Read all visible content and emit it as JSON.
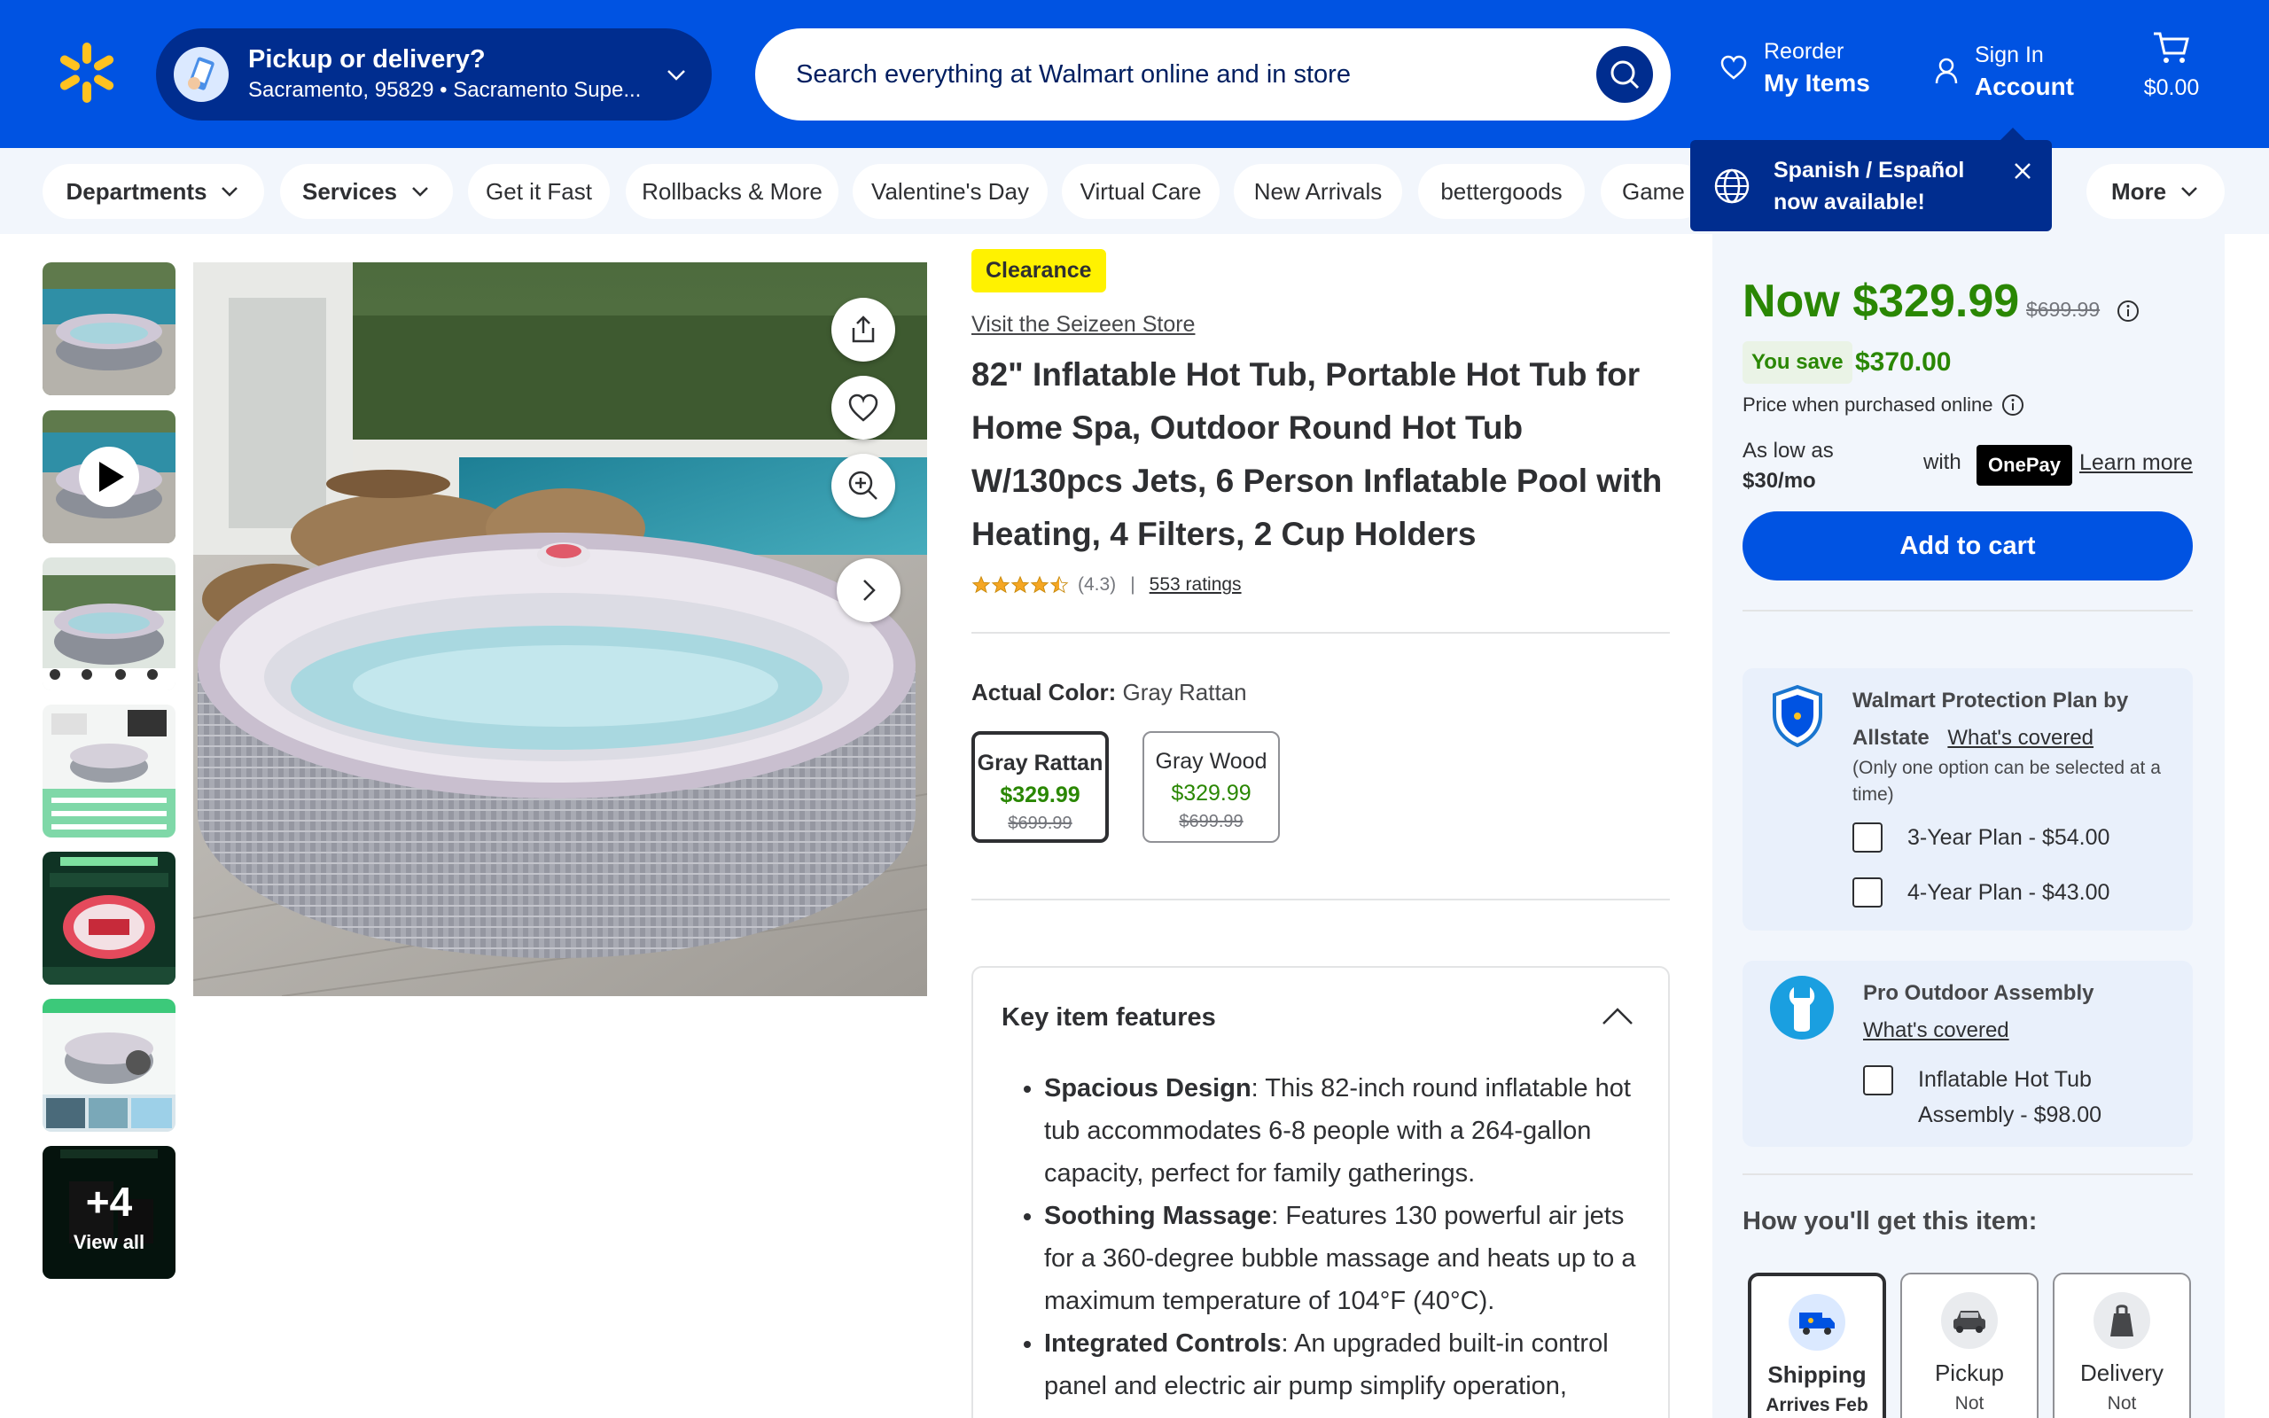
{
  "header": {
    "pickup_title": "Pickup or delivery?",
    "pickup_location": "Sacramento, 95829 • Sacramento Supe...",
    "search_placeholder": "Search everything at Walmart online and in store",
    "reorder_label": "Reorder",
    "reorder_strong": "My Items",
    "signin_label": "Sign In",
    "signin_strong": "Account",
    "cart_total": "$0.00",
    "brand_color": "#0053e2"
  },
  "tooltip": {
    "text_line1": "Spanish / Español",
    "text_line2": "now available!"
  },
  "nav": {
    "items": [
      "Departments",
      "Services",
      "Get it Fast",
      "Rollbacks & More",
      "Valentine's Day",
      "Virtual Care",
      "New Arrivals",
      "bettergoods",
      "Game T"
    ],
    "more": "More"
  },
  "gallery": {
    "more_count": "+4",
    "view_all": "View all"
  },
  "product": {
    "badge": "Clearance",
    "store_link": "Visit the Seizeen Store",
    "title": "82\" Inflatable Hot Tub, Portable Hot Tub for Home Spa, Outdoor Round Hot Tub W/130pcs Jets, 6 Person Inflatable Pool with Heating, 4 Filters, 2 Cup Holders",
    "rating": 4.3,
    "rating_text": "(4.3)",
    "ratings_link": "553 ratings",
    "color_label": "Actual Color:",
    "color_value": "Gray Rattan",
    "variants": [
      {
        "name": "Gray Rattan",
        "price": "$329.99",
        "was": "$699.99",
        "selected": true
      },
      {
        "name": "Gray Wood",
        "price": "$329.99",
        "was": "$699.99",
        "selected": false
      }
    ]
  },
  "features": {
    "title": "Key item features",
    "items": [
      {
        "head": "Spacious Design",
        "text": ": This 82-inch round inflatable hot tub accommodates 6-8 people with a 264-gallon capacity, perfect for family gatherings."
      },
      {
        "head": "Soothing Massage",
        "text": ": Features 130 powerful air jets for a 360-degree bubble massage and heats up to a maximum temperature of 104°F (40°C)."
      },
      {
        "head": "Integrated Controls",
        "text": ": An upgraded built-in control panel and electric air pump simplify operation,"
      }
    ]
  },
  "buybox": {
    "price_now": "Now $329.99",
    "price_was": "$699.99",
    "you_save_label": "You save",
    "you_save_amount": "$370.00",
    "price_note": "Price when purchased online",
    "as_low_as": "As low as",
    "monthly": "$30/mo",
    "with": "with",
    "onepay": "OnePay",
    "learn_more": "Learn more",
    "add_to_cart": "Add to cart",
    "price_color": "#2a8703"
  },
  "protection": {
    "title": "Walmart Protection Plan by Allstate",
    "title_line1": "Walmart Protection Plan by",
    "title_line2": "Allstate",
    "covered": "What's covered",
    "note": "(Only one option can be selected at a time)",
    "options": [
      "3-Year Plan - $54.00",
      "4-Year Plan - $43.00"
    ]
  },
  "assembly": {
    "title": "Pro Outdoor Assembly",
    "covered": "What's covered",
    "option_line1": "Inflatable Hot Tub",
    "option_line2": "Assembly - $98.00"
  },
  "fulfillment": {
    "title": "How you'll get this item:",
    "options": [
      {
        "name": "Shipping",
        "sub": "Arrives Feb",
        "selected": true
      },
      {
        "name": "Pickup",
        "sub": "Not",
        "selected": false
      },
      {
        "name": "Delivery",
        "sub": "Not",
        "selected": false
      }
    ]
  }
}
